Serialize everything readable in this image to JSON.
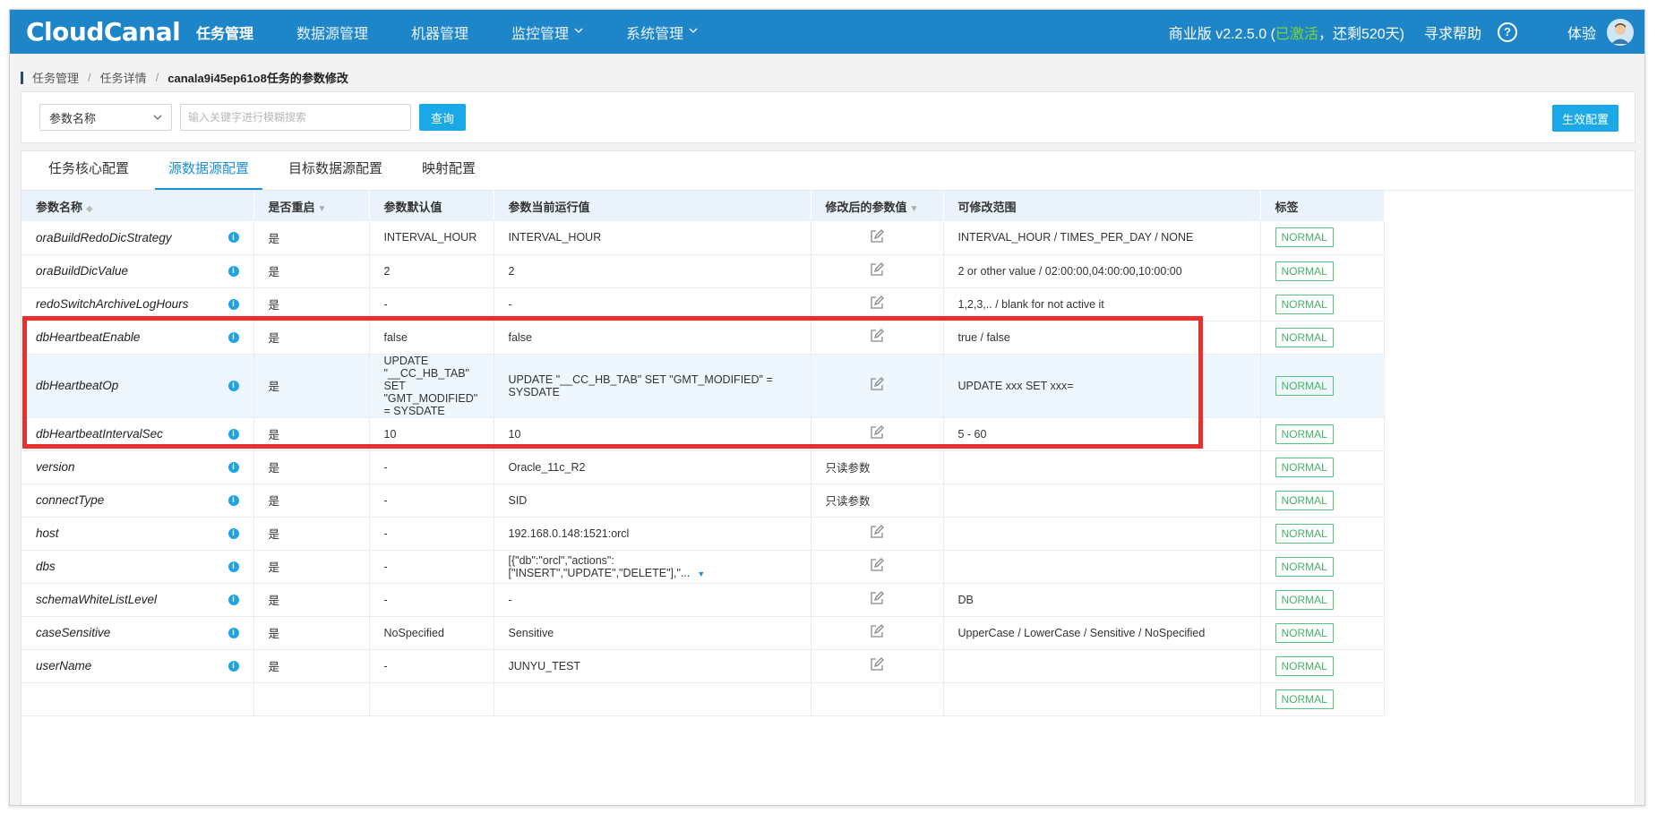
{
  "nav": {
    "logo": "CloudCanal",
    "items": [
      {
        "label": "任务管理",
        "active": true,
        "has_chevron": false
      },
      {
        "label": "数据源管理",
        "active": false,
        "has_chevron": false
      },
      {
        "label": "机器管理",
        "active": false,
        "has_chevron": false
      },
      {
        "label": "监控管理",
        "active": false,
        "has_chevron": true
      },
      {
        "label": "系统管理",
        "active": false,
        "has_chevron": true
      }
    ],
    "version_prefix": "商业版 v2.2.5.0 (",
    "activated": "已激活",
    "remaining": "，还剩520天)",
    "help": "寻求帮助",
    "help_symbol": "?",
    "user": "体验",
    "chevron_glyph": "⌄"
  },
  "breadcrumb": {
    "items": [
      "任务管理",
      "任务详情"
    ],
    "separator": "/",
    "current": "canala9i45ep61o8任务的参数修改"
  },
  "search": {
    "select_value": "参数名称",
    "placeholder": "输入关键字进行模糊搜索",
    "query_button": "查询",
    "apply_button": "生效配置"
  },
  "tabs": [
    {
      "label": "任务核心配置",
      "active": false
    },
    {
      "label": "源数据源配置",
      "active": true
    },
    {
      "label": "目标数据源配置",
      "active": false
    },
    {
      "label": "映射配置",
      "active": false
    }
  ],
  "table": {
    "columns": [
      "参数名称",
      "是否重启",
      "参数默认值",
      "参数当前运行值",
      "修改后的参数值",
      "可修改范围",
      "标签"
    ],
    "rows": [
      {
        "name": "oraBuildRedoDicStrategy",
        "restart": "是",
        "default": "INTERVAL_HOUR",
        "current": "INTERVAL_HOUR",
        "modified": "",
        "editable": true,
        "range": "INTERVAL_HOUR / TIMES_PER_DAY / NONE",
        "tag": "NORMAL",
        "tall": false,
        "highlight": false
      },
      {
        "name": "oraBuildDicValue",
        "restart": "是",
        "default": "2",
        "current": "2",
        "modified": "",
        "editable": true,
        "range": "2 or other value / 02:00:00,04:00:00,10:00:00",
        "tag": "NORMAL",
        "tall": false,
        "highlight": false
      },
      {
        "name": "redoSwitchArchiveLogHours",
        "restart": "是",
        "default": "-",
        "current": "-",
        "modified": "",
        "editable": true,
        "range": "1,2,3,.. / blank for not active it",
        "tag": "NORMAL",
        "tall": false,
        "highlight": false
      },
      {
        "name": "dbHeartbeatEnable",
        "restart": "是",
        "default": "false",
        "current": "false",
        "modified": "",
        "editable": true,
        "range": "true / false",
        "tag": "NORMAL",
        "tall": false,
        "highlight": false
      },
      {
        "name": "dbHeartbeatOp",
        "restart": "是",
        "default": "UPDATE \"__CC_HB_TAB\" SET \"GMT_MODIFIED\" = SYSDATE",
        "current": "UPDATE \"__CC_HB_TAB\" SET \"GMT_MODIFIED\" = SYSDATE",
        "modified": "",
        "editable": true,
        "range": "UPDATE xxx SET xxx=",
        "tag": "NORMAL",
        "tall": true,
        "highlight": true
      },
      {
        "name": "dbHeartbeatIntervalSec",
        "restart": "是",
        "default": "10",
        "current": "10",
        "modified": "",
        "editable": true,
        "range": "5 - 60",
        "tag": "NORMAL",
        "tall": false,
        "highlight": false
      },
      {
        "name": "version",
        "restart": "是",
        "default": "-",
        "current": "Oracle_11c_R2",
        "modified": "只读参数",
        "editable": false,
        "range": "",
        "tag": "NORMAL",
        "tall": false,
        "highlight": false
      },
      {
        "name": "connectType",
        "restart": "是",
        "default": "-",
        "current": "SID",
        "modified": "只读参数",
        "editable": false,
        "range": "",
        "tag": "NORMAL",
        "tall": false,
        "highlight": false
      },
      {
        "name": "host",
        "restart": "是",
        "default": "-",
        "current": "192.168.0.148:1521:orcl",
        "modified": "",
        "editable": true,
        "range": "",
        "tag": "NORMAL",
        "tall": false,
        "highlight": false
      },
      {
        "name": "dbs",
        "restart": "是",
        "default": "-",
        "current": "[{\"db\":\"orcl\",\"actions\":[\"INSERT\",\"UPDATE\",\"DELETE\"],\"...",
        "modified": "",
        "editable": true,
        "range": "",
        "tag": "NORMAL",
        "tall": false,
        "highlight": false,
        "has_dropdown": true
      },
      {
        "name": "schemaWhiteListLevel",
        "restart": "是",
        "default": "-",
        "current": "-",
        "modified": "",
        "editable": true,
        "range": "DB",
        "tag": "NORMAL",
        "tall": false,
        "highlight": false
      },
      {
        "name": "caseSensitive",
        "restart": "是",
        "default": "NoSpecified",
        "current": "Sensitive",
        "modified": "",
        "editable": true,
        "range": "UpperCase / LowerCase / Sensitive / NoSpecified",
        "tag": "NORMAL",
        "tall": false,
        "highlight": false
      },
      {
        "name": "userName",
        "restart": "是",
        "default": "-",
        "current": "JUNYU_TEST",
        "modified": "",
        "editable": true,
        "range": "",
        "tag": "NORMAL",
        "tall": false,
        "highlight": false
      },
      {
        "name": "",
        "restart": "",
        "default": "",
        "current": "",
        "modified": "",
        "editable": false,
        "range": "",
        "tag": "NORMAL",
        "tall": false,
        "highlight": false,
        "partial": true
      }
    ]
  },
  "colors": {
    "nav_bg": "#1e86c8",
    "accent": "#1aa8e6",
    "tab_active": "#1e90d8",
    "tag_green": "#46b066",
    "highlight_red": "#e8312f",
    "row_highlight": "#eef7fd"
  },
  "icons": {
    "info": "info-icon",
    "edit": "edit-icon",
    "sort": "sort-icon",
    "filter": "filter-icon",
    "chevron": "chevron-down-icon",
    "avatar": "avatar-icon"
  }
}
